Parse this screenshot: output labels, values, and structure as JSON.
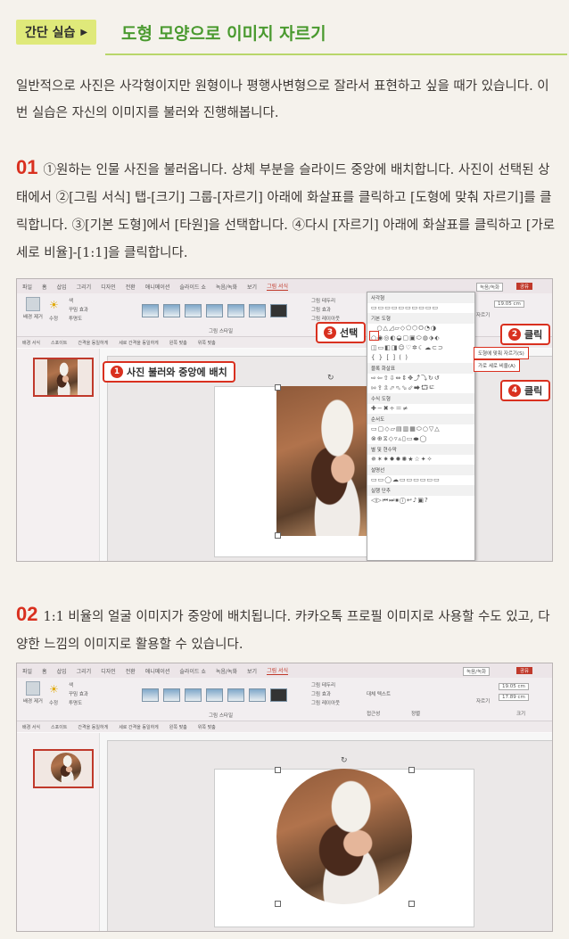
{
  "header": {
    "badge": "간단 실습",
    "title": "도형 모양으로 이미지 자르기"
  },
  "intro": "일반적으로 사진은 사각형이지만 원형이나 평행사변형으로 잘라서 표현하고 싶을 때가 있습니다. 이번 실습은 자신의 이미지를 불러와 진행해봅니다.",
  "steps": [
    {
      "num": "01",
      "text": "①원하는 인물 사진을 불러옵니다. 상체 부분을 슬라이드 중앙에 배치합니다. 사진이 선택된 상태에서 ②[그림 서식] 탭-[크기] 그룹-[자르기] 아래에 화살표를 클릭하고 [도형에 맞춰 자르기]를 클릭합니다. ③[기본 도형]에서 [타원]을 선택합니다. ④다시 [자르기] 아래에 화살표를 클릭하고 [가로 세로 비율]-[1:1]을 클릭합니다."
    },
    {
      "num": "02",
      "text": "1:1 비율의 얼굴 이미지가 중앙에 배치됩니다. 카카오톡 프로필 이미지로 사용할 수도 있고, 다양한 느낌의 이미지로 활용할 수 있습니다."
    }
  ],
  "ui": {
    "tabs": [
      "파일",
      "홈",
      "삽입",
      "그리기",
      "디자인",
      "전환",
      "애니메이션",
      "슬라이드 쇼",
      "녹음/녹화",
      "보기",
      "그림 서식"
    ],
    "ribbon": {
      "bg_remove": "배경 제거",
      "correct": "수정",
      "color": "색",
      "art": "꾸밈 효과",
      "transparency": "투명도",
      "pic_style": "그림 스타일",
      "border": "그림 테두리",
      "effect": "그림 효과",
      "layout": "그림 레이아웃",
      "crop": "자르기",
      "height": "19.05 cm",
      "width": "17.89 cm",
      "size": "크기",
      "alt_text": "대체 텍스트",
      "accessibility": "접근성",
      "arrange": "정렬"
    },
    "ribbon2": [
      "배경 서식",
      "스포이트",
      "간격을 동일하게",
      "세로 간격을 동일하게",
      "왼쪽 맞춤",
      "위쪽 맞춤"
    ],
    "dropdown": {
      "recent": "사각형",
      "basic": "기본 도형",
      "arrows": "블록 화살표",
      "equation": "수식 도형",
      "flowchart": "순서도",
      "stars": "별 및 현수막",
      "callouts": "설명선",
      "action": "실행 단추"
    },
    "menu": {
      "crop_to_shape": "도형에 맞춰 자르기(S)",
      "aspect": "가로 세로 비율(A)"
    },
    "share": "공유",
    "record": "녹음/녹화"
  },
  "callouts": {
    "c1": "사진 불러와 중앙에 배치",
    "c2": "클릭",
    "c3": "선택",
    "c4": "클릭"
  },
  "colors": {
    "accent_red": "#d9301f",
    "title_green": "#4a9a2f",
    "badge_lime": "#dfe97a"
  }
}
